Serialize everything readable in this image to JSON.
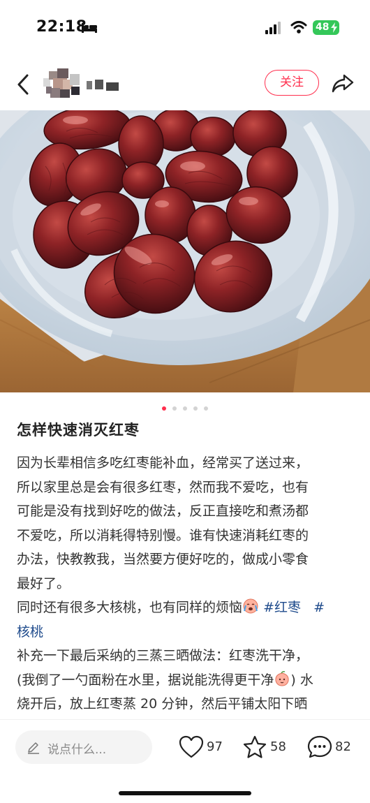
{
  "status_bar": {
    "time": "22:18",
    "battery": "48"
  },
  "nav": {
    "follow_label": "关注"
  },
  "post": {
    "title": "怎样快速消灭红枣",
    "body_lines": [
      "因为长辈相信多吃红枣能补血，经常买了送过来，",
      "所以家里总是会有很多红枣，然而我不爱吃，也有",
      "可能是没有找到好吃的做法，反正直接吃和煮汤都",
      "不爱吃，所以消耗得特别慢。谁有快速消耗红枣的",
      "办法，快教教我，当然要方便好吃的，做成小零食",
      "最好了。"
    ],
    "line7_text": "同时还有很多大核桃，也有同样的烦恼",
    "hashtag_1": "#红枣",
    "hashtag_2_part1": "#",
    "hashtag_2_part2": "核桃",
    "line9": "补充一下最后采纳的三蒸三晒做法：红枣洗干净，",
    "line10_a": "(我倒了一勺面粉在水里，据说能洗得更干净",
    "line10_b": ") 水",
    "line11": "烧开后，放上红枣蒸 20 分钟，然后平铺太阳下晒"
  },
  "bottom_bar": {
    "comment_placeholder": "说点什么...",
    "likes": "97",
    "collects": "58",
    "comments": "82"
  },
  "carousel": {
    "total": 5,
    "active_index": 0
  },
  "colors": {
    "accent": "#ff2e4d",
    "hashtag": "#1f4b8c",
    "battery": "#34c759"
  }
}
